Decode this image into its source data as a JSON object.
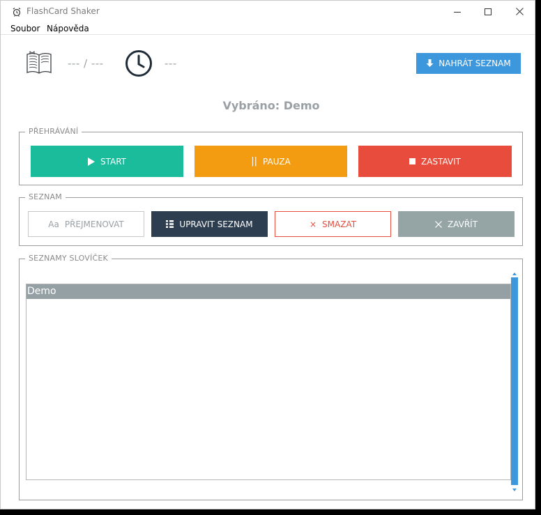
{
  "window": {
    "title": "FlashCard Shaker"
  },
  "menu": {
    "items": [
      "Soubor",
      "Nápověda"
    ]
  },
  "header": {
    "progress": "--- / ---",
    "time": "---",
    "upload_label": "NAHRÁT SEZNAM",
    "selected": "Vybráno: Demo"
  },
  "playback": {
    "legend": "PŘEHRÁVÁNÍ",
    "start_label": "START",
    "pause_label": "PAUZA",
    "pause_glyph": "||",
    "stop_label": "ZASTAVIT"
  },
  "list_group": {
    "legend": "SEZNAM",
    "rename_glyph": "Aa",
    "rename_label": "PŘEJMENOVAT",
    "edit_label": "UPRAVIT SEZNAM",
    "delete_glyph": "×",
    "delete_label": "SMAZAT",
    "close_label": "ZAVŘÍT"
  },
  "vocab": {
    "legend": "SEZNAMY SLOVÍČEK",
    "items": [
      "Demo"
    ]
  },
  "colors": {
    "accent_blue": "#3d97dc",
    "start_green": "#1abc9c",
    "pause_orange": "#f39c12",
    "stop_red": "#e74c3c",
    "edit_navy": "#2c3e50",
    "close_gray": "#95a5a6",
    "muted_text": "#9aa0a4"
  }
}
